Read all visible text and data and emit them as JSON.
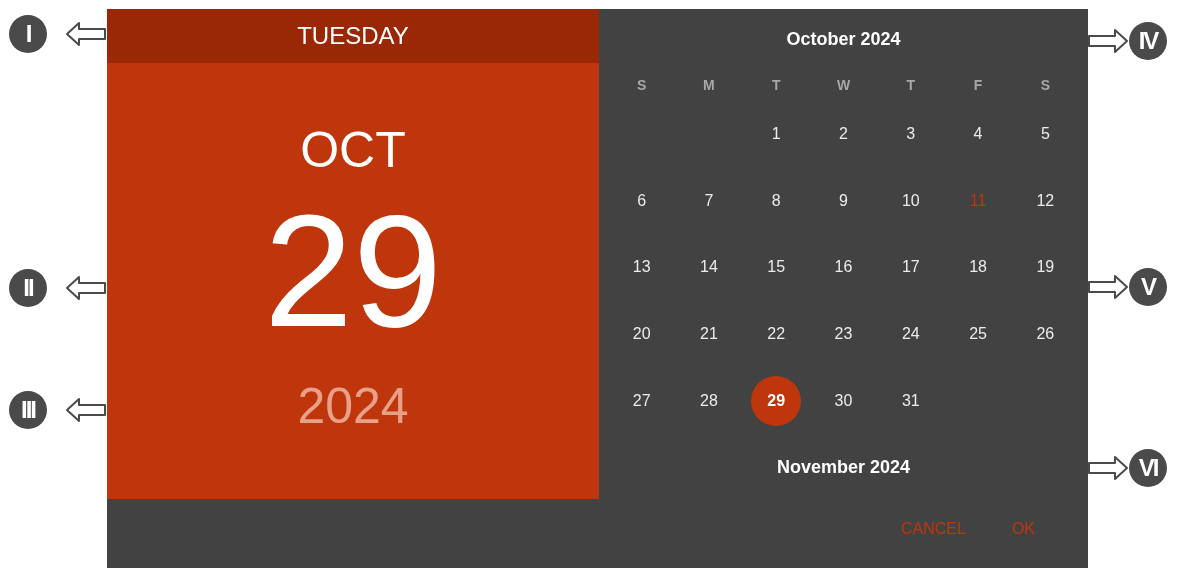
{
  "header": {
    "weekday": "TUESDAY",
    "month": "OCT",
    "day": "29",
    "year": "2024"
  },
  "calendar": {
    "title": "October 2024",
    "weekdays": [
      "S",
      "M",
      "T",
      "W",
      "T",
      "F",
      "S"
    ],
    "weeks": [
      [
        {
          "kind": "blank"
        },
        {
          "kind": "blank"
        },
        {
          "kind": "day",
          "label": "1",
          "selected": false,
          "today": false
        },
        {
          "kind": "day",
          "label": "2",
          "selected": false,
          "today": false
        },
        {
          "kind": "day",
          "label": "3",
          "selected": false,
          "today": false
        },
        {
          "kind": "day",
          "label": "4",
          "selected": false,
          "today": false
        },
        {
          "kind": "day",
          "label": "5",
          "selected": false,
          "today": false
        }
      ],
      [
        {
          "kind": "day",
          "label": "6",
          "selected": false,
          "today": false
        },
        {
          "kind": "day",
          "label": "7",
          "selected": false,
          "today": false
        },
        {
          "kind": "day",
          "label": "8",
          "selected": false,
          "today": false
        },
        {
          "kind": "day",
          "label": "9",
          "selected": false,
          "today": false
        },
        {
          "kind": "day",
          "label": "10",
          "selected": false,
          "today": false
        },
        {
          "kind": "day",
          "label": "11",
          "selected": false,
          "today": true
        },
        {
          "kind": "day",
          "label": "12",
          "selected": false,
          "today": false
        }
      ],
      [
        {
          "kind": "day",
          "label": "13",
          "selected": false,
          "today": false
        },
        {
          "kind": "day",
          "label": "14",
          "selected": false,
          "today": false
        },
        {
          "kind": "day",
          "label": "15",
          "selected": false,
          "today": false
        },
        {
          "kind": "day",
          "label": "16",
          "selected": false,
          "today": false
        },
        {
          "kind": "day",
          "label": "17",
          "selected": false,
          "today": false
        },
        {
          "kind": "day",
          "label": "18",
          "selected": false,
          "today": false
        },
        {
          "kind": "day",
          "label": "19",
          "selected": false,
          "today": false
        }
      ],
      [
        {
          "kind": "day",
          "label": "20",
          "selected": false,
          "today": false
        },
        {
          "kind": "day",
          "label": "21",
          "selected": false,
          "today": false
        },
        {
          "kind": "day",
          "label": "22",
          "selected": false,
          "today": false
        },
        {
          "kind": "day",
          "label": "23",
          "selected": false,
          "today": false
        },
        {
          "kind": "day",
          "label": "24",
          "selected": false,
          "today": false
        },
        {
          "kind": "day",
          "label": "25",
          "selected": false,
          "today": false
        },
        {
          "kind": "day",
          "label": "26",
          "selected": false,
          "today": false
        }
      ],
      [
        {
          "kind": "day",
          "label": "27",
          "selected": false,
          "today": false
        },
        {
          "kind": "day",
          "label": "28",
          "selected": false,
          "today": false
        },
        {
          "kind": "day",
          "label": "29",
          "selected": true,
          "today": false
        },
        {
          "kind": "day",
          "label": "30",
          "selected": false,
          "today": false
        },
        {
          "kind": "day",
          "label": "31",
          "selected": false,
          "today": false
        },
        {
          "kind": "blank"
        },
        {
          "kind": "blank"
        }
      ]
    ],
    "next_title": "November 2024"
  },
  "buttons": [
    "CANCEL",
    "OK"
  ],
  "left_callouts": [
    {
      "label": "I"
    },
    {
      "label": "II"
    },
    {
      "label": "III"
    }
  ],
  "right_callouts": [
    {
      "label": "IV"
    },
    {
      "label": "V"
    },
    {
      "label": "VI"
    }
  ]
}
